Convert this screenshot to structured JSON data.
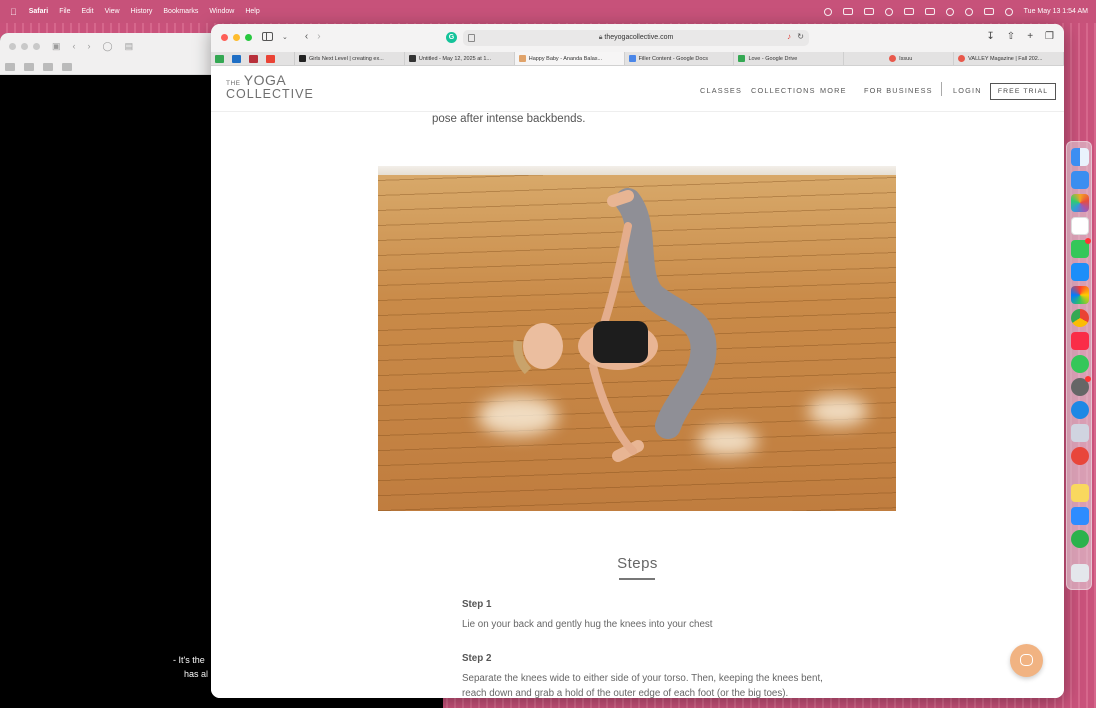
{
  "menubar": {
    "app": "Safari",
    "items": [
      "File",
      "Edit",
      "View",
      "History",
      "Bookmarks",
      "Window",
      "Help"
    ],
    "clock": "Tue May 13  1:54 AM"
  },
  "background_window": {
    "subtitle_line1": "- It's the",
    "subtitle_line2": "has al"
  },
  "browser": {
    "url": "theyogacollective.com",
    "tabs": [
      {
        "label": "Girls Next Level | creating ex...",
        "color": "#222222"
      },
      {
        "label": "Untitled - May 12, 2025 at 1...",
        "color": "#333333"
      },
      {
        "label": "Happy Baby - Ananda Balas...",
        "color": "#e0a36a"
      },
      {
        "label": "Filler Content - Google Docs",
        "color": "#4a86e8"
      },
      {
        "label": "Love - Google Drive",
        "color": "#34a853"
      },
      {
        "label": "Issuu",
        "color": "#e8584b"
      },
      {
        "label": "VALLEY Magazine | Fall 202...",
        "color": "#e8584b"
      }
    ]
  },
  "site": {
    "logo_the": "THE",
    "logo_yoga": "YOGA",
    "logo_collective": "COLLECTIVE",
    "nav": {
      "classes": "CLASSES",
      "collections": "COLLECTIONS",
      "more": "MORE",
      "for_business": "FOR BUSINESS",
      "login": "LOGIN",
      "free_trial": "FREE TRIAL"
    }
  },
  "article": {
    "intro_tail": "pose after intense backbends.",
    "steps_heading": "Steps",
    "steps": [
      {
        "label": "Step 1",
        "text": "Lie on your back and gently hug the knees into your chest"
      },
      {
        "label": "Step 2",
        "text": "Separate the knees wide to either side of your torso. Then, keeping the knees bent, reach down and grab a hold of the outer edge of each foot (or the big toes)."
      }
    ]
  },
  "colors": {
    "desktop": "#c9527b",
    "chat_button": "#f1b382"
  }
}
